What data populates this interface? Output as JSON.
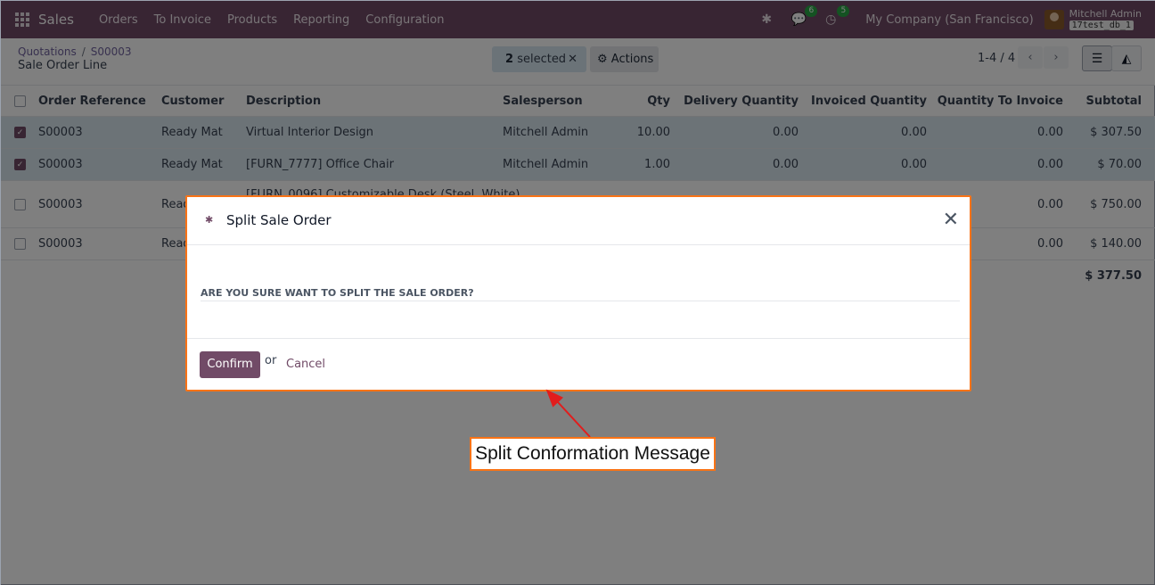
{
  "navbar": {
    "app_name": "Sales",
    "menu": [
      "Orders",
      "To Invoice",
      "Products",
      "Reporting",
      "Configuration"
    ],
    "chat_badge": "6",
    "activity_badge": "5",
    "company": "My Company (San Francisco)",
    "user_name": "Mitchell Admin",
    "db_name": "17test_db_1"
  },
  "control": {
    "breadcrumb_root": "Quotations",
    "breadcrumb_sep": "/",
    "breadcrumb_current": "S00003",
    "subtitle": "Sale Order Line",
    "selected_count": "2",
    "selected_label": "selected",
    "actions_label": "Actions",
    "pager": "1-4 / 4"
  },
  "table": {
    "headers": [
      "Order Reference",
      "Customer",
      "Description",
      "Salesperson",
      "Qty",
      "Delivery Quantity",
      "Invoiced Quantity",
      "Quantity To Invoice",
      "Subtotal"
    ],
    "rows": [
      {
        "ref": "S00003",
        "customer": "Ready Mat",
        "desc": "Virtual Interior Design",
        "salesperson": "Mitchell Admin",
        "qty": "10.00",
        "delivered": "0.00",
        "invoiced": "0.00",
        "to_invoice": "0.00",
        "subtotal": "$ 307.50",
        "checked": true
      },
      {
        "ref": "S00003",
        "customer": "Ready Mat",
        "desc": "[FURN_7777] Office Chair",
        "salesperson": "Mitchell Admin",
        "qty": "1.00",
        "delivered": "0.00",
        "invoiced": "0.00",
        "to_invoice": "0.00",
        "subtotal": "$ 70.00",
        "checked": true
      },
      {
        "ref": "S00003",
        "customer": "Read",
        "desc": "[FURN_0096] Customizable Desk (Steel, White)",
        "salesperson": "",
        "qty": "",
        "delivered": "",
        "invoiced": "",
        "to_invoice": "0.00",
        "subtotal": "$ 750.00",
        "checked": false
      },
      {
        "ref": "S00003",
        "customer": "Read",
        "desc": "",
        "salesperson": "",
        "qty": "",
        "delivered": "",
        "invoiced": "",
        "to_invoice": "0.00",
        "subtotal": "$ 140.00",
        "checked": false
      }
    ],
    "total": "$ 377.50"
  },
  "dialog": {
    "title": "Split Sale Order",
    "question": "ARE YOU SURE WANT TO SPLIT THE SALE ORDER?",
    "confirm_label": "Confirm",
    "or_label": "or",
    "cancel_label": "Cancel",
    "close_glyph": "✕"
  },
  "annotation": {
    "label": "Split Conformation Message",
    "color": "#f97316"
  },
  "colors": {
    "brand": "#714b67",
    "selected_row": "#d8e6ee",
    "badge": "#28a745"
  }
}
